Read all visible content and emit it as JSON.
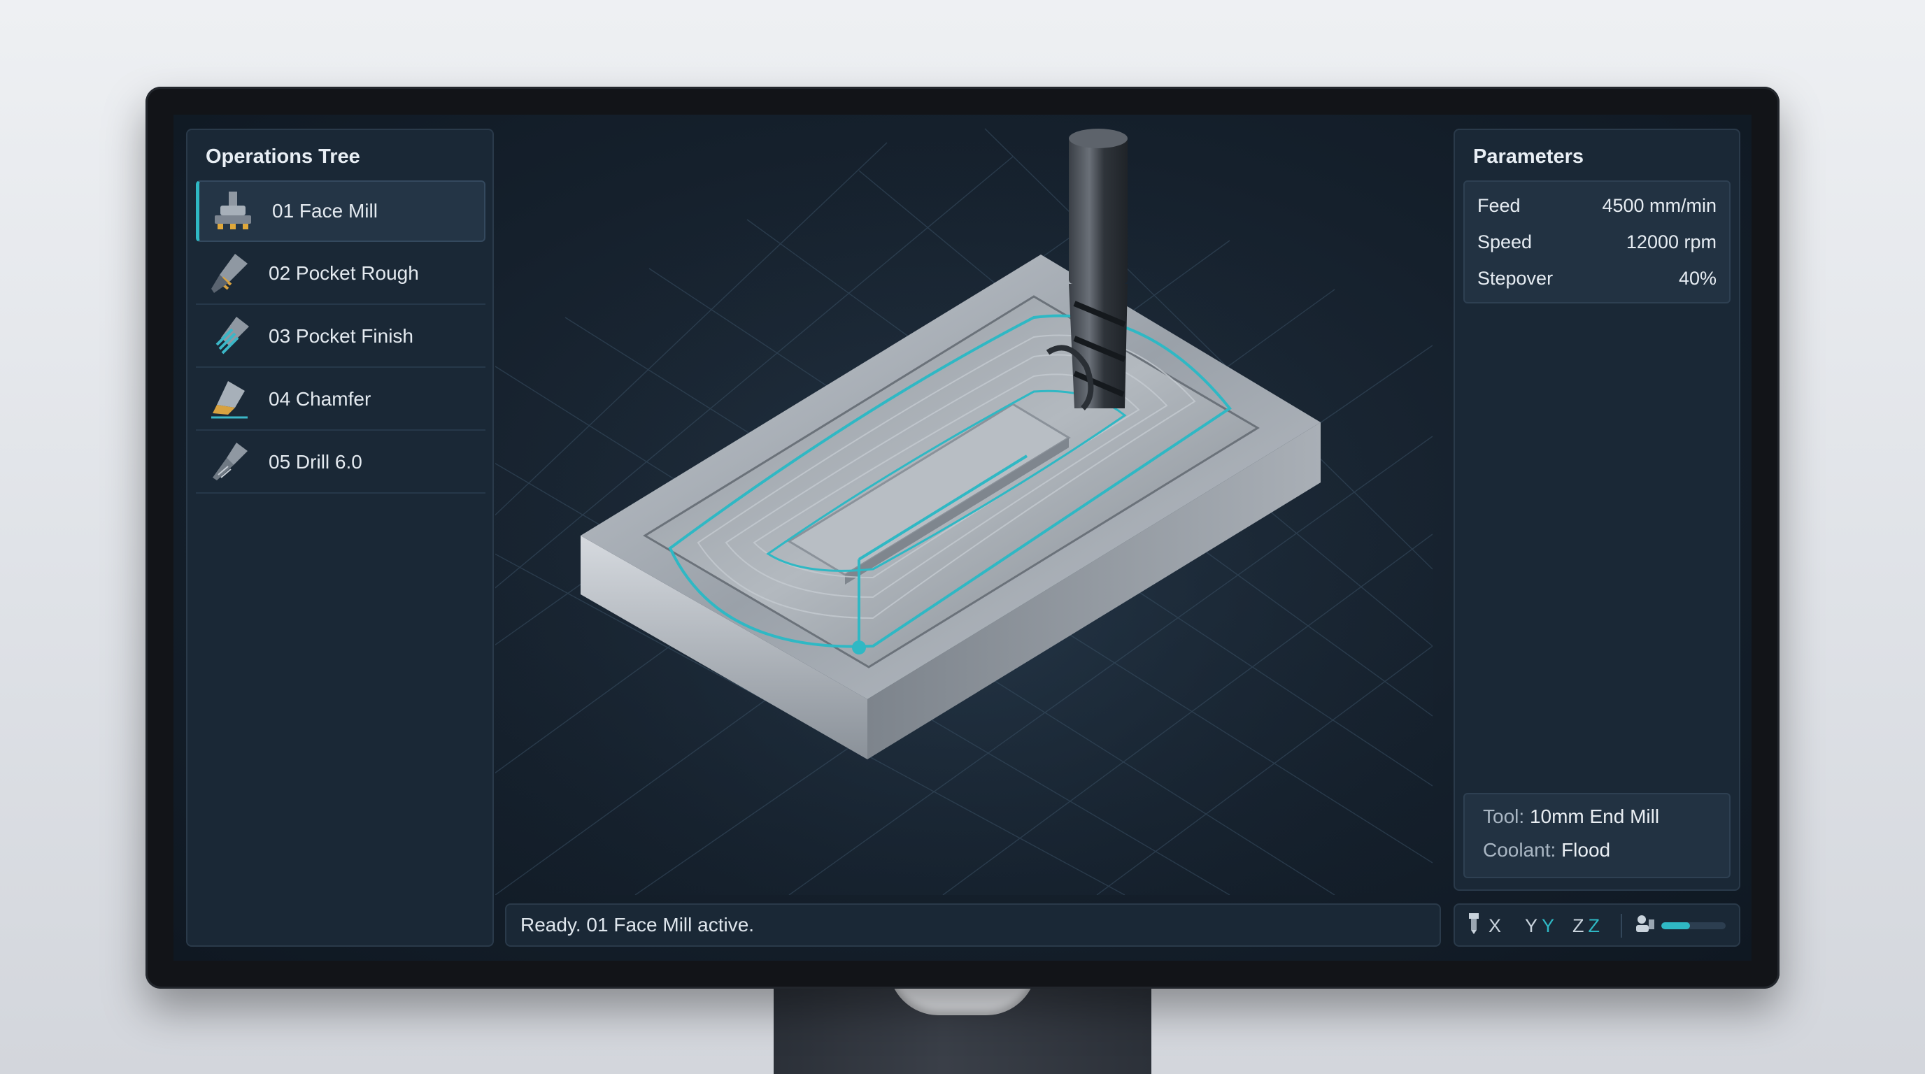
{
  "operations": {
    "title": "Operations Tree",
    "items": [
      {
        "label": "01 Face Mill",
        "icon": "face-mill-icon",
        "active": true
      },
      {
        "label": "02 Pocket Rough",
        "icon": "pocket-rough-icon",
        "active": false
      },
      {
        "label": "03 Pocket Finish",
        "icon": "pocket-finish-icon",
        "active": false
      },
      {
        "label": "04 Chamfer",
        "icon": "chamfer-icon",
        "active": false
      },
      {
        "label": "05 Drill 6.0",
        "icon": "drill-icon",
        "active": false
      }
    ]
  },
  "parameters": {
    "title": "Parameters",
    "rows": [
      {
        "key": "Feed",
        "value": "4500 mm/min"
      },
      {
        "key": "Speed",
        "value": "12000 rpm"
      },
      {
        "key": "Stepover",
        "value": "40%"
      }
    ],
    "tool_key": "Tool:",
    "tool_value": "10mm End Mill",
    "coolant_key": "Coolant:",
    "coolant_value": "Flood"
  },
  "status": {
    "message": "Ready. 01 Face Mill active."
  },
  "coords": {
    "x_label": "X",
    "y_label": "Y",
    "y_value": "Y",
    "z_label": "Z",
    "z_value": "Z",
    "progress": 0.45
  },
  "colors": {
    "accent": "#2fb8c4",
    "panel": "#1a2836",
    "background": "#15202c"
  }
}
